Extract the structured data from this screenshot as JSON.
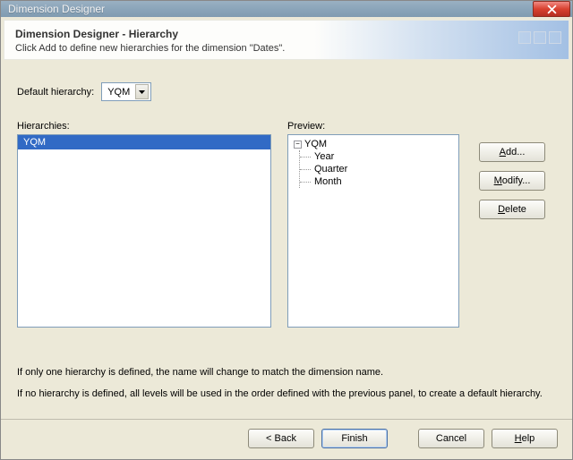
{
  "window": {
    "title": "Dimension Designer"
  },
  "banner": {
    "title": "Dimension Designer - Hierarchy",
    "subtitle": "Click Add to define new hierarchies for the dimension \"Dates\"."
  },
  "default_hierarchy": {
    "label": "Default hierarchy:",
    "value": "YQM"
  },
  "hierarchies": {
    "label": "Hierarchies:",
    "selected": "YQM"
  },
  "preview": {
    "label": "Preview:",
    "root": "YQM",
    "children": [
      "Year",
      "Quarter",
      "Month"
    ]
  },
  "side_buttons": {
    "add": "Add...",
    "modify": "Modify...",
    "delete": "Delete"
  },
  "notes": {
    "line1": "If only one hierarchy is defined, the name will change to match the dimension name.",
    "line2": "If no hierarchy is defined, all levels will be used in the order defined with the previous panel, to create a default hierarchy."
  },
  "footer": {
    "back": "< Back",
    "finish": "Finish",
    "cancel": "Cancel",
    "help": "Help"
  }
}
